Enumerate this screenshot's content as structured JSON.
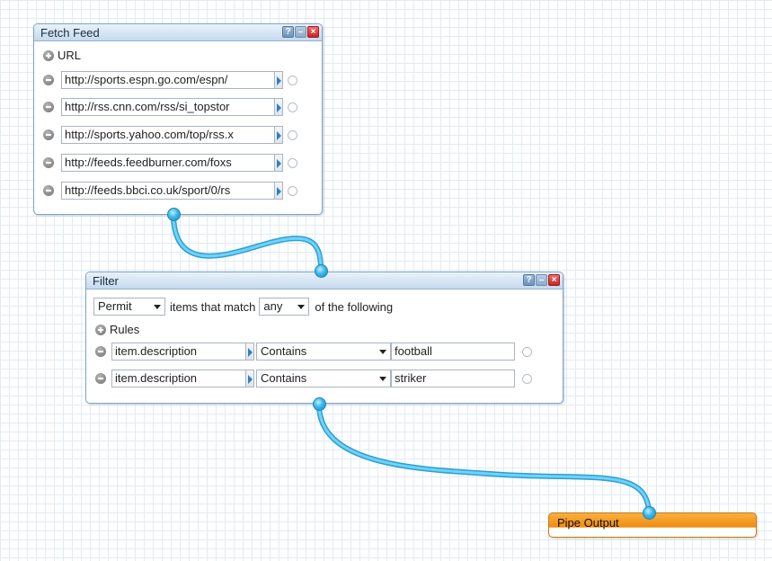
{
  "fetch_feed": {
    "title": "Fetch Feed",
    "help_label": "?",
    "url_label": "URL",
    "urls": [
      "http://sports.espn.go.com/espn/",
      "http://rss.cnn.com/rss/si_topstor",
      "http://sports.yahoo.com/top/rss.x",
      "http://feeds.feedburner.com/foxs",
      "http://feeds.bbci.co.uk/sport/0/rs"
    ]
  },
  "filter": {
    "title": "Filter",
    "help_label": "?",
    "mode": "Permit",
    "text_items_match": "items that match",
    "match": "any",
    "text_of_following": "of the following",
    "rules_label": "Rules",
    "rules": [
      {
        "field": "item.description",
        "op": "Contains",
        "value": "football"
      },
      {
        "field": "item.description",
        "op": "Contains",
        "value": "striker"
      }
    ]
  },
  "pipe_output": {
    "title": "Pipe Output"
  },
  "colors": {
    "wire": "#4cc3f0",
    "module_border": "#7ea3c6",
    "output_orange": "#f08b12"
  }
}
